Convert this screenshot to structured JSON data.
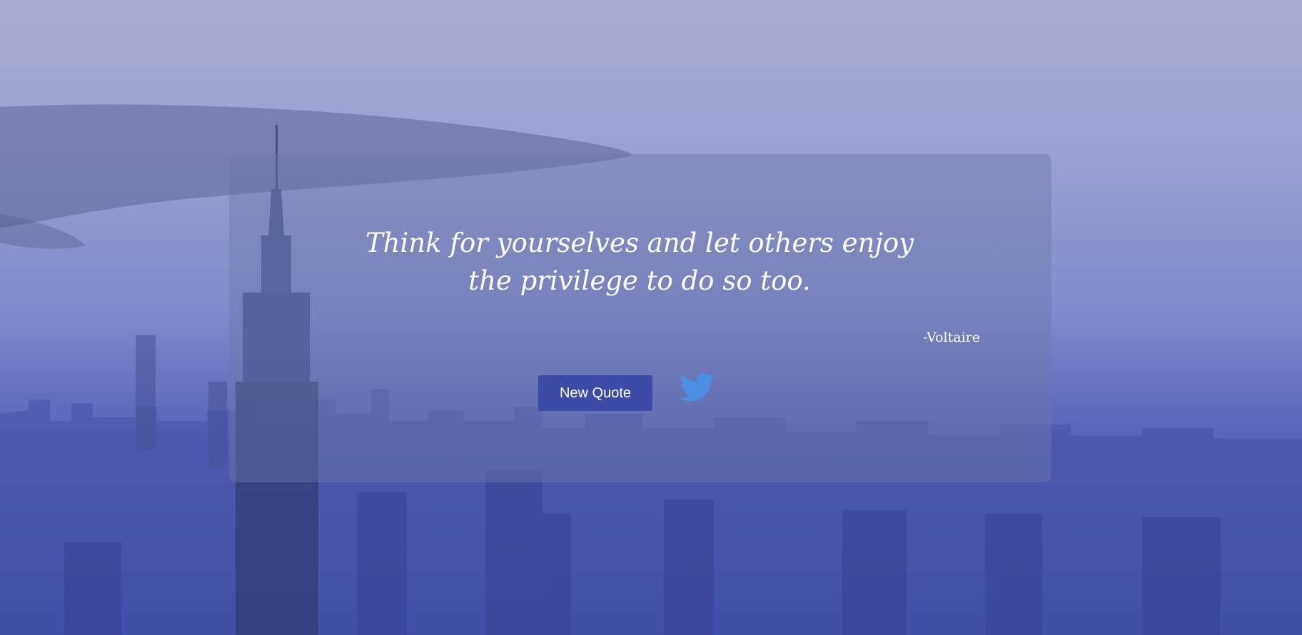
{
  "quote": {
    "text": "Think for yourselves and let others enjoy the privilege to do so too.",
    "author": "-Voltaire"
  },
  "actions": {
    "new_quote_label": "New Quote",
    "tweet_icon": "twitter-bird-icon"
  },
  "colors": {
    "accent_button": "#3d4aa6",
    "twitter_blue": "#4a90e2",
    "overlay_card": "#6e76aa"
  }
}
